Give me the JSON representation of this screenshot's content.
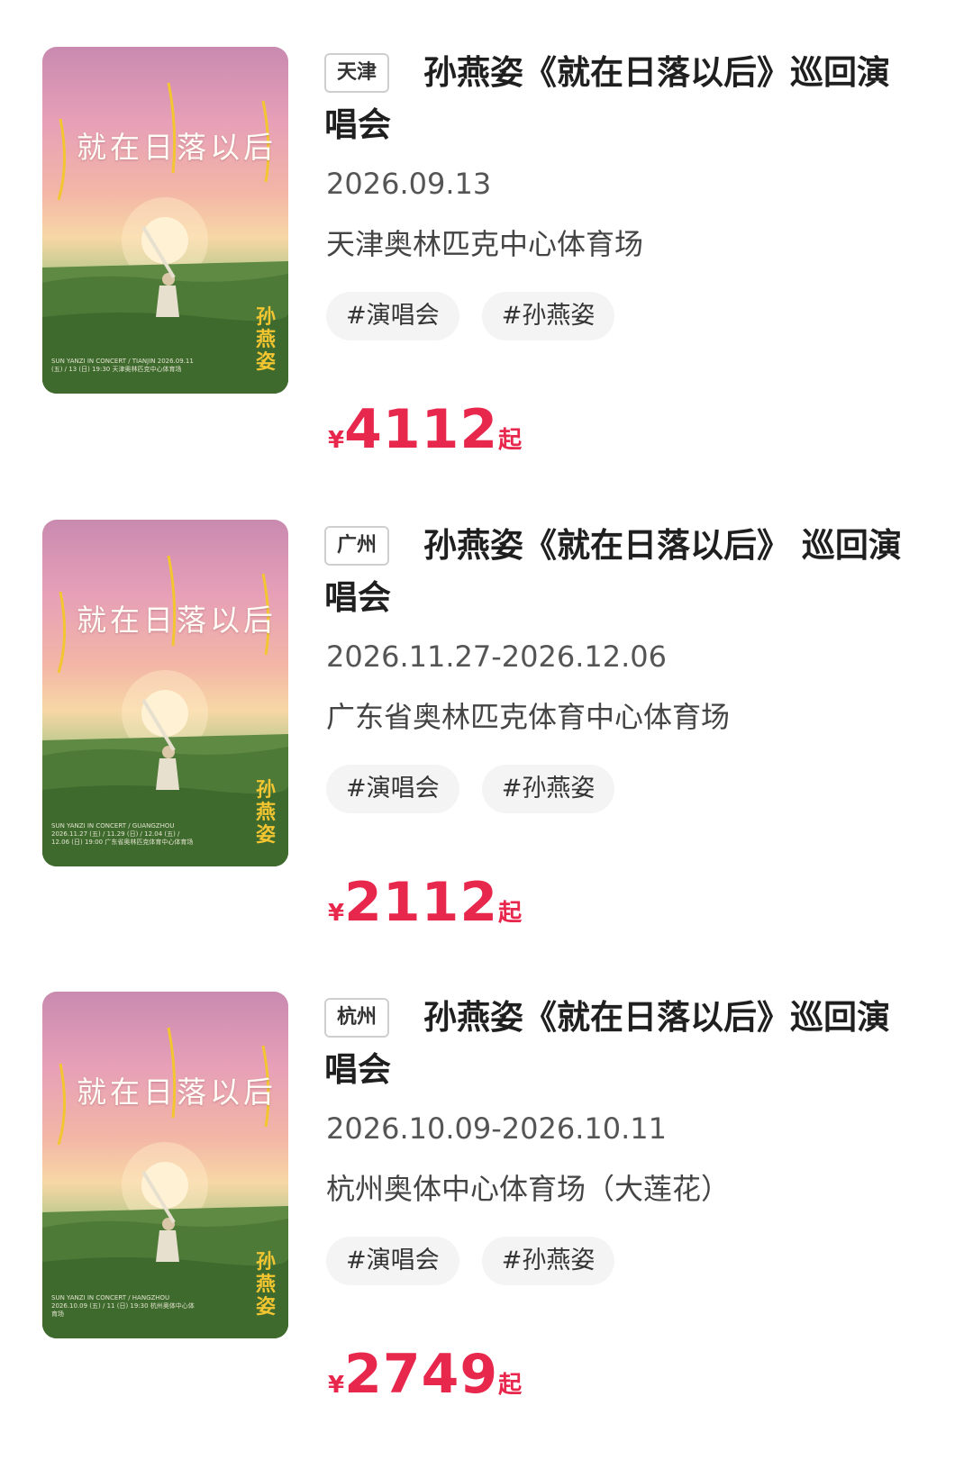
{
  "events": [
    {
      "city": "天津",
      "title": "孙燕姿《就在日落以后》巡回演唱会",
      "date": "2026.09.13",
      "venue": "天津奥林匹克中心体育场",
      "tags": [
        "#演唱会",
        "#孙燕姿"
      ],
      "currency": "¥",
      "price": "4112",
      "price_suffix": "起",
      "poster": {
        "title": "就在日落以后",
        "artist": "孙燕姿",
        "fine_print": "SUN YANZI IN CONCERT / TIANJIN 2026.09.11 (五) / 13 (日) 19:30 天津奥林匹克中心体育场"
      }
    },
    {
      "city": "广州",
      "title": "孙燕姿《就在日落以后》 巡回演唱会",
      "date": "2026.11.27-2026.12.06",
      "venue": "广东省奥林匹克体育中心体育场",
      "tags": [
        "#演唱会",
        "#孙燕姿"
      ],
      "currency": "¥",
      "price": "2112",
      "price_suffix": "起",
      "poster": {
        "title": "就在日落以后",
        "artist": "孙燕姿",
        "fine_print": "SUN YANZI IN CONCERT / GUANGZHOU 2026.11.27 (五) / 11.29 (日) / 12.04 (五) / 12.06 (日) 19:00 广东省奥林匹克体育中心体育场"
      }
    },
    {
      "city": "杭州",
      "title": "孙燕姿《就在日落以后》巡回演唱会",
      "date": "2026.10.09-2026.10.11",
      "venue": "杭州奥体中心体育场（大莲花）",
      "tags": [
        "#演唱会",
        "#孙燕姿"
      ],
      "currency": "¥",
      "price": "2749",
      "price_suffix": "起",
      "poster": {
        "title": "就在日落以后",
        "artist": "孙燕姿",
        "fine_print": "SUN YANZI IN CONCERT / HANGZHOU 2026.10.09 (五) / 11 (日) 19:30 杭州奥体中心体育场"
      }
    }
  ],
  "colors": {
    "price": "#e8274d",
    "tag_bg": "#f4f4f4",
    "city_border": "#cfcfcf"
  }
}
